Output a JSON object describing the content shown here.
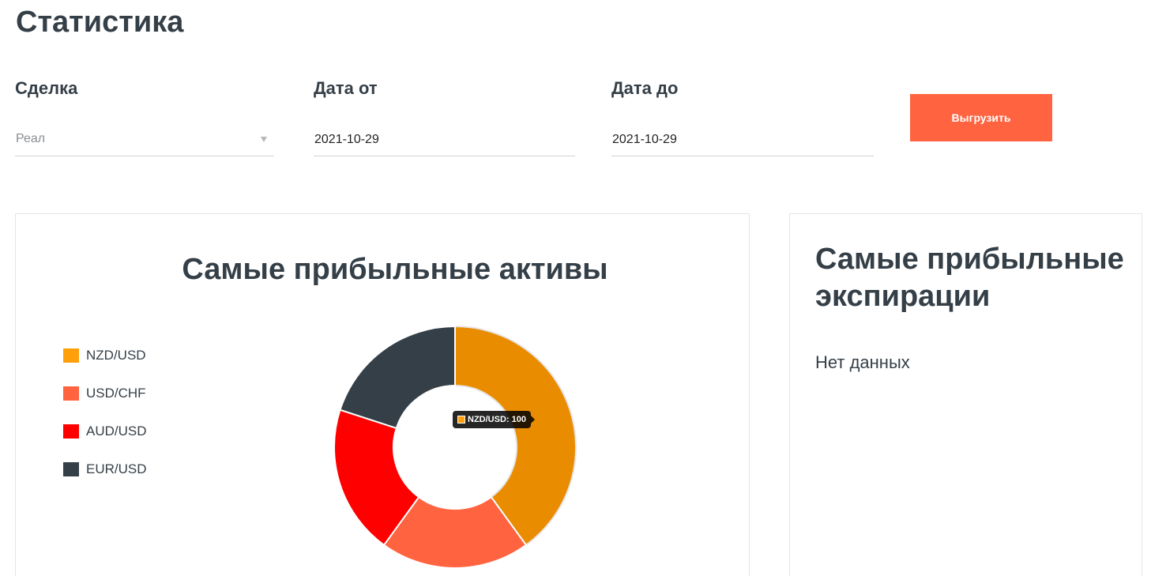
{
  "page": {
    "title": "Статистика"
  },
  "filters": {
    "deal": {
      "label": "Сделка",
      "value": "Реал"
    },
    "date_from": {
      "label": "Дата от",
      "value": "2021-10-29"
    },
    "date_to": {
      "label": "Дата до",
      "value": "2021-10-29"
    },
    "export_button": {
      "label": "Выгрузить"
    }
  },
  "tooltip": {
    "text": "NZD/USD: 100"
  },
  "expirations": {
    "title": "Самые прибыльные экспирации",
    "empty_text": "Нет данных"
  },
  "colors": {
    "accent": "#FF6340",
    "text": "#353F47",
    "muted": "#8A8F94"
  },
  "chart_data": {
    "type": "pie",
    "title": "Самые прибыльные активы",
    "categories": [
      "NZD/USD",
      "USD/CHF",
      "AUD/USD",
      "EUR/USD"
    ],
    "values": [
      100,
      50,
      50,
      50
    ],
    "colors": [
      "#FFA00A",
      "#FF6340",
      "#FF0000",
      "#353F47"
    ],
    "legend": "left",
    "donut": true
  }
}
